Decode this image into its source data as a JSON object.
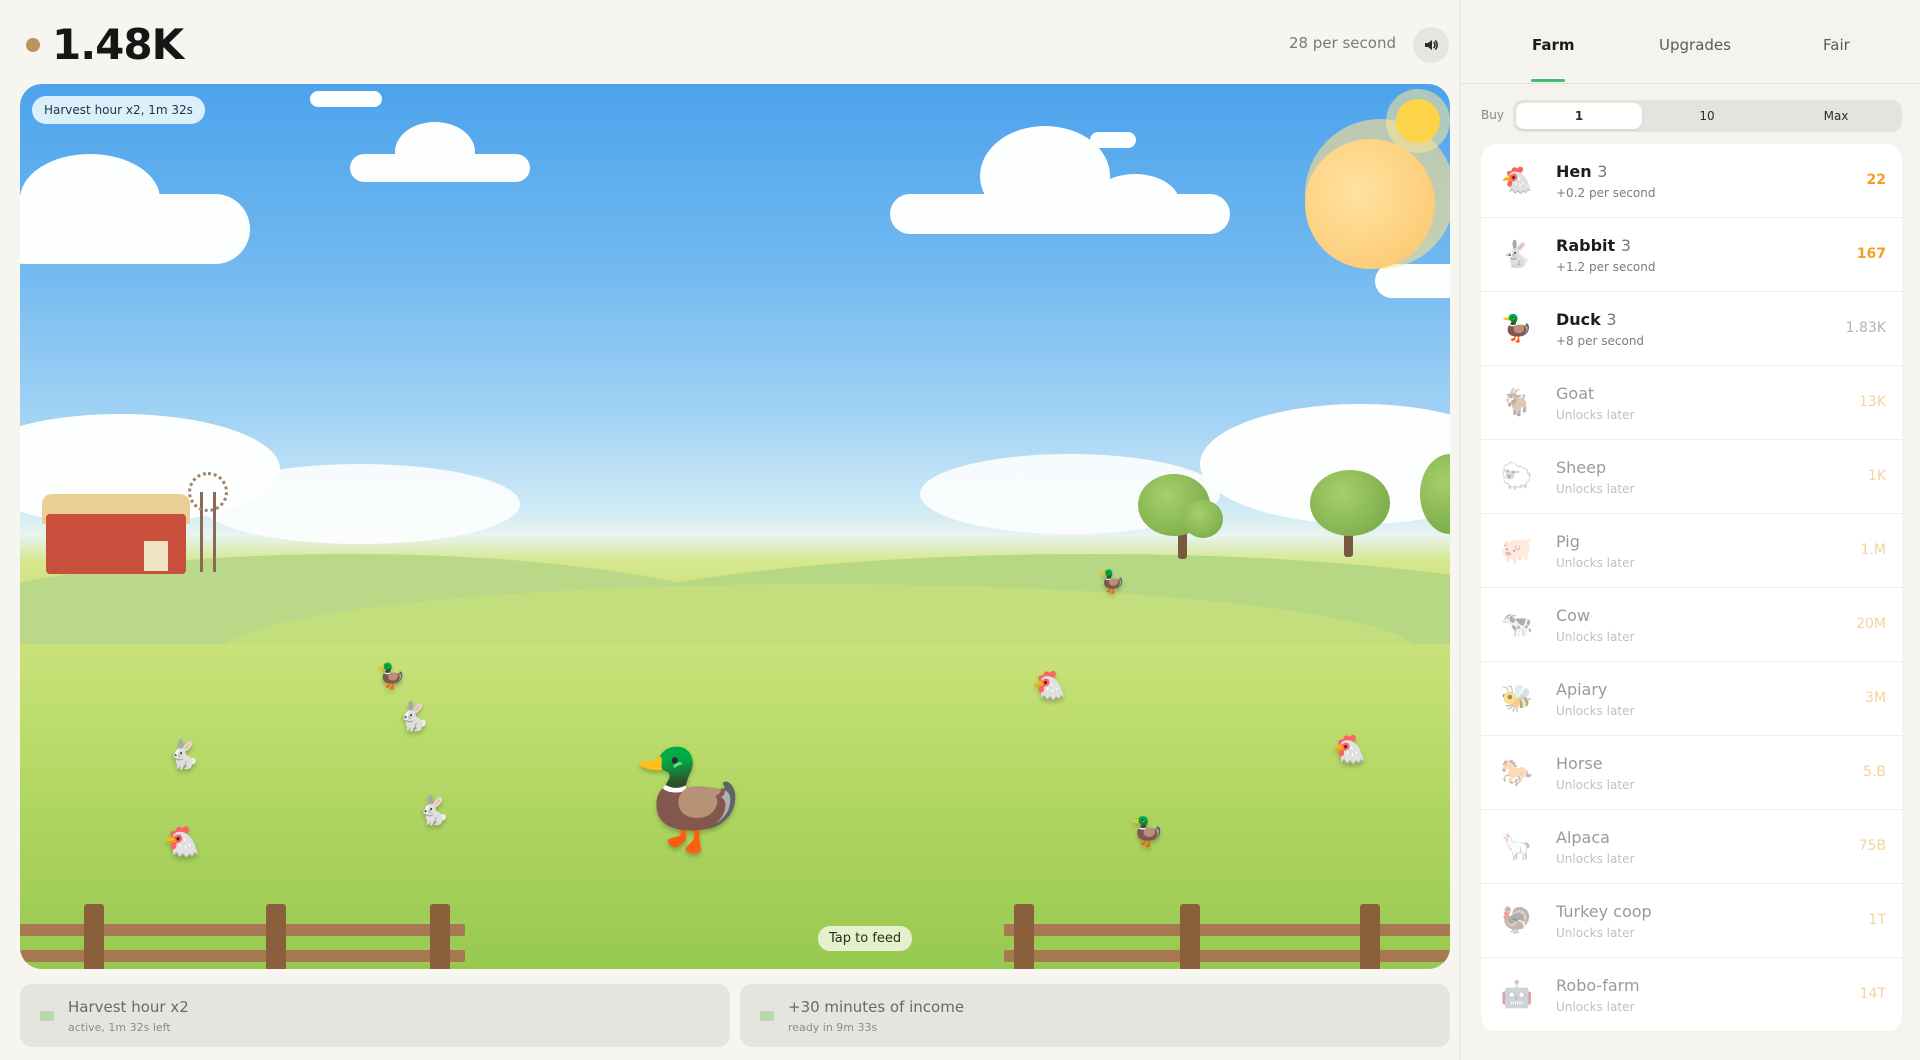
{
  "header": {
    "balance": "1.48K",
    "rate": "28 per second",
    "sound_icon": "speaker-icon"
  },
  "scene": {
    "badge": "Harvest hour x2, 1m 32s",
    "tap_hint": "Tap to feed"
  },
  "boosters": [
    {
      "title": "Harvest hour x2",
      "subtitle": "active, 1m 32s left"
    },
    {
      "title": "+30 minutes of income",
      "subtitle": "ready in 9m 33s"
    }
  ],
  "tabs": [
    {
      "label": "Farm",
      "active": true
    },
    {
      "label": "Upgrades",
      "active": false
    },
    {
      "label": "Fair",
      "active": false
    }
  ],
  "buy": {
    "label": "Buy",
    "options": [
      "1",
      "10",
      "Max"
    ],
    "selected": "1"
  },
  "animals": [
    {
      "name": "Hen",
      "count": "3",
      "sub": "+0.2 per second",
      "price": "22",
      "icon": "🐔",
      "state": "affordable"
    },
    {
      "name": "Rabbit",
      "count": "3",
      "sub": "+1.2 per second",
      "price": "167",
      "icon": "🐇",
      "state": "affordable"
    },
    {
      "name": "Duck",
      "count": "3",
      "sub": "+8 per second",
      "price": "1.83K",
      "icon": "🦆",
      "state": "unaffordable"
    },
    {
      "name": "Goat",
      "count": "",
      "sub": "Unlocks later",
      "price": "13K",
      "icon": "🐐",
      "state": "locked"
    },
    {
      "name": "Sheep",
      "count": "",
      "sub": "Unlocks later",
      "price": "1K",
      "icon": "🐑",
      "state": "locked"
    },
    {
      "name": "Pig",
      "count": "",
      "sub": "Unlocks later",
      "price": "1.M",
      "icon": "🐖",
      "state": "locked"
    },
    {
      "name": "Cow",
      "count": "",
      "sub": "Unlocks later",
      "price": "20M",
      "icon": "🐄",
      "state": "locked"
    },
    {
      "name": "Apiary",
      "count": "",
      "sub": "Unlocks later",
      "price": "3M",
      "icon": "🐝",
      "state": "locked"
    },
    {
      "name": "Horse",
      "count": "",
      "sub": "Unlocks later",
      "price": "5.B",
      "icon": "🐎",
      "state": "locked"
    },
    {
      "name": "Alpaca",
      "count": "",
      "sub": "Unlocks later",
      "price": "75B",
      "icon": "🦙",
      "state": "locked"
    },
    {
      "name": "Turkey coop",
      "count": "",
      "sub": "Unlocks later",
      "price": "1T",
      "icon": "🦃",
      "state": "locked"
    },
    {
      "name": "Robo-farm",
      "count": "",
      "sub": "Unlocks later",
      "price": "14T",
      "icon": "🤖",
      "state": "locked"
    }
  ],
  "colors": {
    "accent_green": "#3fbf74",
    "price_orange": "#f0a023",
    "coin": "#fdd449"
  }
}
